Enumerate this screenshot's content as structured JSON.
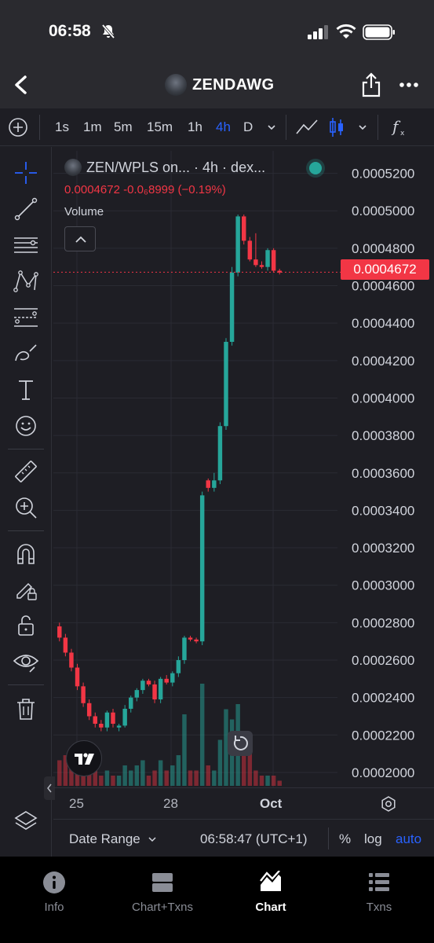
{
  "status": {
    "time": "06:58"
  },
  "header": {
    "title": "ZENDAWG"
  },
  "timeframes": [
    {
      "label": "1s",
      "active": false
    },
    {
      "label": "1m",
      "active": false
    },
    {
      "label": "5m",
      "active": false
    },
    {
      "label": "15m",
      "active": false
    },
    {
      "label": "1h",
      "active": false
    },
    {
      "label": "4h",
      "active": true
    },
    {
      "label": "D",
      "active": false
    }
  ],
  "legend": {
    "symbol": "ZEN/WPLS on...  · 4h · dex...",
    "quote": "0.0004672  -0.0₆8999 (−0.19%)",
    "volume_label": "Volume"
  },
  "current_price": "0.0004672",
  "time_axis": {
    "labels": [
      "25",
      "28",
      "Oct"
    ]
  },
  "controls": {
    "date_range": "Date Range",
    "clock": "06:58:47 (UTC+1)",
    "percent": "%",
    "log": "log",
    "auto": "auto"
  },
  "tabs": [
    {
      "label": "Info",
      "active": false
    },
    {
      "label": "Chart+Txns",
      "active": false
    },
    {
      "label": "Chart",
      "active": true
    },
    {
      "label": "Txns",
      "active": false
    }
  ],
  "colors": {
    "up": "#26a69a",
    "down": "#f23645",
    "accent": "#2962ff",
    "background": "#1e1e24"
  },
  "chart_data": {
    "type": "candlestick",
    "pair": "ZEN/WPLS",
    "interval": "4h",
    "y_ticks": [
      0.00052,
      0.0005,
      0.00048,
      0.00046,
      0.00044,
      0.00042,
      0.0004,
      0.00038,
      0.00036,
      0.00034,
      0.00032,
      0.0003,
      0.00028,
      0.00026,
      0.00024,
      0.00022,
      0.0002
    ],
    "y_tick_labels": [
      "0.0005200",
      "0.0005000",
      "0.0004800",
      "0.0004600",
      "0.0004400",
      "0.0004200",
      "0.0004000",
      "0.0003800",
      "0.0003600",
      "0.0003400",
      "0.0003200",
      "0.0003000",
      "0.0002800",
      "0.0002600",
      "0.0002400",
      "0.0002200",
      "0.0002000"
    ],
    "ylim": [
      0.000192,
      0.000532
    ],
    "x_labels": [
      "25",
      "28",
      "Oct"
    ],
    "last_price": 0.0004672,
    "candles": [
      {
        "o": 0.000278,
        "h": 0.00028,
        "l": 0.00027,
        "c": 0.000272,
        "v": 0.25
      },
      {
        "o": 0.000272,
        "h": 0.000274,
        "l": 0.000262,
        "c": 0.000264,
        "v": 0.3
      },
      {
        "o": 0.000264,
        "h": 0.000266,
        "l": 0.000254,
        "c": 0.000256,
        "v": 0.35
      },
      {
        "o": 0.000256,
        "h": 0.000258,
        "l": 0.000244,
        "c": 0.000246,
        "v": 0.3
      },
      {
        "o": 0.000246,
        "h": 0.000248,
        "l": 0.000235,
        "c": 0.000237,
        "v": 0.25
      },
      {
        "o": 0.000237,
        "h": 0.000239,
        "l": 0.000228,
        "c": 0.00023,
        "v": 0.2
      },
      {
        "o": 0.00023,
        "h": 0.000232,
        "l": 0.000224,
        "c": 0.000226,
        "v": 0.15
      },
      {
        "o": 0.000226,
        "h": 0.000228,
        "l": 0.000222,
        "c": 0.000224,
        "v": 0.1
      },
      {
        "o": 0.000224,
        "h": 0.000233,
        "l": 0.000222,
        "c": 0.000232,
        "v": 0.15
      },
      {
        "o": 0.000232,
        "h": 0.000234,
        "l": 0.000224,
        "c": 0.000226,
        "v": 0.1
      },
      {
        "o": 0.000224,
        "h": 0.000226,
        "l": 0.000222,
        "c": 0.000225,
        "v": 0.1
      },
      {
        "o": 0.000225,
        "h": 0.000236,
        "l": 0.000224,
        "c": 0.000234,
        "v": 0.2
      },
      {
        "o": 0.000234,
        "h": 0.000241,
        "l": 0.000232,
        "c": 0.00024,
        "v": 0.15
      },
      {
        "o": 0.00024,
        "h": 0.000245,
        "l": 0.000238,
        "c": 0.000244,
        "v": 0.2
      },
      {
        "o": 0.000244,
        "h": 0.00025,
        "l": 0.000242,
        "c": 0.000249,
        "v": 0.25
      },
      {
        "o": 0.000249,
        "h": 0.00025,
        "l": 0.000246,
        "c": 0.000247,
        "v": 0.1
      },
      {
        "o": 0.000247,
        "h": 0.000249,
        "l": 0.000237,
        "c": 0.000239,
        "v": 0.15
      },
      {
        "o": 0.000239,
        "h": 0.000251,
        "l": 0.000237,
        "c": 0.00025,
        "v": 0.25
      },
      {
        "o": 0.00025,
        "h": 0.000252,
        "l": 0.000247,
        "c": 0.000248,
        "v": 0.15
      },
      {
        "o": 0.000248,
        "h": 0.000254,
        "l": 0.000246,
        "c": 0.000253,
        "v": 0.2
      },
      {
        "o": 0.000253,
        "h": 0.000262,
        "l": 0.000251,
        "c": 0.00026,
        "v": 0.3
      },
      {
        "o": 0.00026,
        "h": 0.000273,
        "l": 0.000258,
        "c": 0.000272,
        "v": 0.7
      },
      {
        "o": 0.000272,
        "h": 0.000273,
        "l": 0.00027,
        "c": 0.000271,
        "v": 0.15
      },
      {
        "o": 0.000271,
        "h": 0.000272,
        "l": 0.000269,
        "c": 0.00027,
        "v": 0.15
      },
      {
        "o": 0.00027,
        "h": 0.00035,
        "l": 0.000268,
        "c": 0.000348,
        "v": 1.0
      },
      {
        "o": 0.000356,
        "h": 0.000357,
        "l": 0.00035,
        "c": 0.000352,
        "v": 0.2
      },
      {
        "o": 0.000352,
        "h": 0.00036,
        "l": 0.00035,
        "c": 0.000356,
        "v": 0.15
      },
      {
        "o": 0.000356,
        "h": 0.000387,
        "l": 0.000354,
        "c": 0.000385,
        "v": 0.45
      },
      {
        "o": 0.000385,
        "h": 0.000432,
        "l": 0.000383,
        "c": 0.00043,
        "v": 0.75
      },
      {
        "o": 0.00043,
        "h": 0.00047,
        "l": 0.000428,
        "c": 0.000467,
        "v": 0.65
      },
      {
        "o": 0.000467,
        "h": 0.000498,
        "l": 0.000465,
        "c": 0.000497,
        "v": 0.8
      },
      {
        "o": 0.000497,
        "h": 0.000498,
        "l": 0.000482,
        "c": 0.000484,
        "v": 0.45
      },
      {
        "o": 0.000484,
        "h": 0.000486,
        "l": 0.000473,
        "c": 0.000474,
        "v": 0.35
      },
      {
        "o": 0.000474,
        "h": 0.000488,
        "l": 0.00047,
        "c": 0.000471,
        "v": 0.15
      },
      {
        "o": 0.000471,
        "h": 0.000473,
        "l": 0.000469,
        "c": 0.00047,
        "v": 0.1
      },
      {
        "o": 0.00047,
        "h": 0.00048,
        "l": 0.000468,
        "c": 0.000479,
        "v": 0.1
      },
      {
        "o": 0.000479,
        "h": 0.00048,
        "l": 0.000467,
        "c": 0.000468,
        "v": 0.1
      },
      {
        "o": 0.000468,
        "h": 0.000469,
        "l": 0.000466,
        "c": 0.000467,
        "v": 0.05
      }
    ]
  }
}
